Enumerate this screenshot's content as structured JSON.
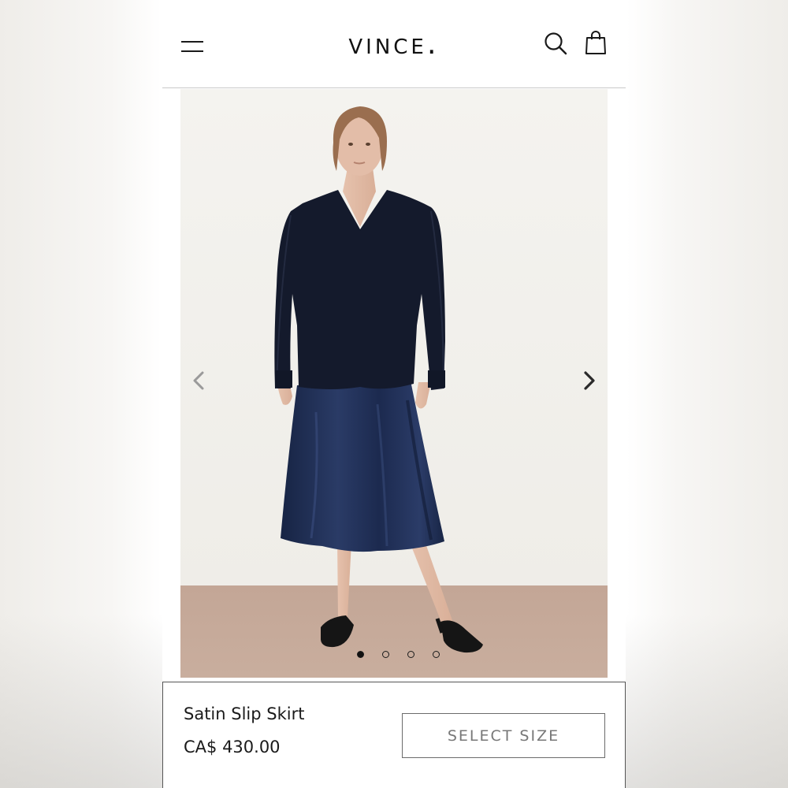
{
  "header": {
    "menu_icon": "hamburger-menu-icon",
    "logo_text": "VINCE.",
    "search_icon": "search-icon",
    "bag_icon": "shopping-bag-icon"
  },
  "gallery": {
    "prev_icon": "chevron-left-icon",
    "next_icon": "chevron-right-icon",
    "image_count": 4,
    "active_index": 0
  },
  "product": {
    "name": "Satin Slip Skirt",
    "price": "CA$ 430.00",
    "select_size_label": "SELECT SIZE"
  },
  "colors": {
    "text": "#1a1a1a",
    "button_border": "#6b6b6b",
    "button_text": "#777777",
    "sweater": "#141a2c",
    "skirt": "#1f2d52",
    "floor": "#c8ad9b",
    "wall": "#f3f2ee"
  }
}
